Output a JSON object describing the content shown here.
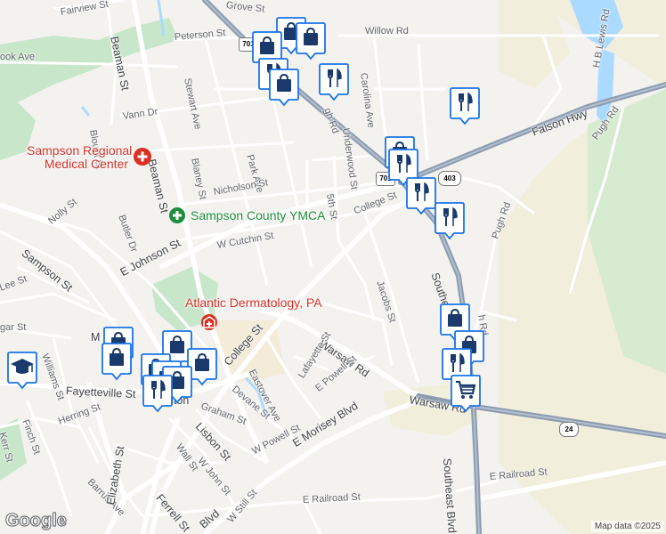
{
  "map": {
    "streets": {
      "grove_st": "Grove St",
      "fairview_st": "Fairview St",
      "peterson_st": "Peterson St",
      "willow_rd": "Willow Rd",
      "hook_ave": "ook Ave",
      "vann_dr": "Vann Dr",
      "blount_st": "Blount St",
      "beaman_st_north": "Beaman St",
      "beaman_st": "Beaman St",
      "stewart_ave": "Stewart Ave",
      "park_ave": "Park Ave",
      "blaney_st": "Blaney St",
      "butler_dr": "Butler Dr",
      "nicholson_st": "Nicholson St",
      "nolly_st": "Nolly St",
      "sampson_st": "Sampson St",
      "e_johnson_st": "E Johnson St",
      "w_cutchin_st": "W Cutchin St",
      "fifth_st": "5th St",
      "college_st_ne": "College St",
      "college_st": "College St",
      "carolina_ave": "Carolina Ave",
      "underwood_st": "Underwood St",
      "beaverdam_dr": "Beaverdam Dr",
      "high_rd": "gh Rd",
      "faison_hwy": "Faison Hwy",
      "h_b_lewis_rd": "H B Lewis Rd",
      "pugh_rd_north": "Pugh Rd",
      "pugh_rd": "Pugh Rd",
      "southeast_blvd_mid": "Southeast",
      "southeast_blvd": "Southeast Blvd",
      "jacobs_st": "Jacobs St",
      "warsaw_rd": "Warsaw Rd",
      "warsaw_rd_east": "Warsaw Rd",
      "eastover_ave": "Eastover Ave",
      "lafayette_st": "Lafayette St",
      "e_powell_st": "E Powell St",
      "w_powell_st": "W Powell St",
      "e_morisey_blvd": "E Morisey Blvd",
      "lee_st": "Lee St",
      "sugar_st": "gar St",
      "williams_st": "Williams St",
      "fayetteville_st": "Fayetteville St",
      "finch_st": "Finch St",
      "herring_st": "Herring St",
      "kerr_st": "Kerr St",
      "devane_st": "Devane St",
      "graham_st": "Graham St",
      "lisbon_st": "Lisbon St",
      "wall_st": "Wall St",
      "w_john_st": "W John St",
      "barrus_ave": "Barrus Ave",
      "elizabeth_st": "Elizabeth St",
      "ferrell_st": "Ferrell St",
      "e_railroad_st": "E Railroad St",
      "e_railroad_st_east": "E Railroad St",
      "w_still_st": "W Still St",
      "blvd": "Blvd",
      "clinton_fragment": "nton",
      "m_fragment": "M",
      "ch_rd_fragment": "h Rd"
    },
    "places": {
      "hospital": "Sampson Regional\nMedical Center",
      "ymca": "Sampson County YMCA",
      "dermatology": "Atlantic Dermatology, PA"
    },
    "route_shields": {
      "us_701_north": "701",
      "us_701_mid": "701",
      "nc_403": "403",
      "nc_24": "24"
    },
    "pin_icons": [
      "shopping-bag-icon",
      "restaurant-icon",
      "shopping-cart-icon",
      "school-icon"
    ],
    "colors": {
      "background": "#f3f2ef",
      "park": "#c8e6c9",
      "water": "#aadaff",
      "highway": "#8c9bb0",
      "farmland": "#f1eedc",
      "pin": "#1a73e8",
      "hospital": "#d93025",
      "ymca": "#1e8e3e"
    },
    "attribution": {
      "logo": "Google",
      "map_data": "Map data ©2025"
    }
  }
}
